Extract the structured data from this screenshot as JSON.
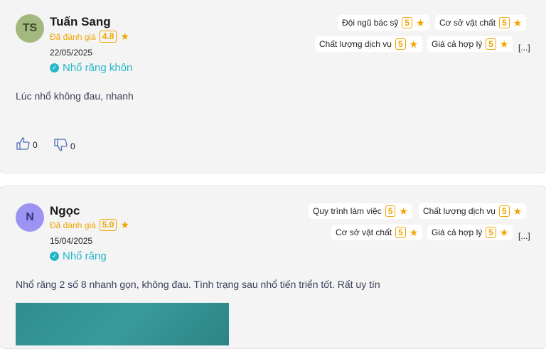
{
  "reviews": [
    {
      "initials": "TS",
      "avatar_color": "#a3b87e",
      "name": "Tuấn Sang",
      "rated_label": "Đã đánh giá",
      "score": "4.8",
      "date": "22/05/2025",
      "service": "Nhổ răng khôn",
      "criteria": [
        {
          "label": "Đội ngũ bác sỹ",
          "score": "5"
        },
        {
          "label": "Cơ sở vật chất",
          "score": "5"
        },
        {
          "label": "Chất lượng dịch vụ",
          "score": "5"
        },
        {
          "label": "Giá cả hợp lý",
          "score": "5"
        }
      ],
      "more": "[...]",
      "text": "Lúc nhổ không đau, nhanh",
      "likes": "0",
      "dislikes": "0"
    },
    {
      "initials": "N",
      "avatar_color": "#9d93f2",
      "name": "Ngọc",
      "rated_label": "Đã đánh giá",
      "score": "5.0",
      "date": "15/04/2025",
      "service": "Nhổ răng",
      "criteria": [
        {
          "label": "Quy trình làm việc",
          "score": "5"
        },
        {
          "label": "Chất lượng dịch vụ",
          "score": "5"
        },
        {
          "label": "Cơ sở vật chất",
          "score": "5"
        },
        {
          "label": "Giá cả hợp lý",
          "score": "5"
        }
      ],
      "more": "[...]",
      "text": "Nhổ răng 2 số 8 nhanh gọn, không đau. Tình trạng sau nhổ tiến triển tốt. Rất uy tín"
    }
  ]
}
